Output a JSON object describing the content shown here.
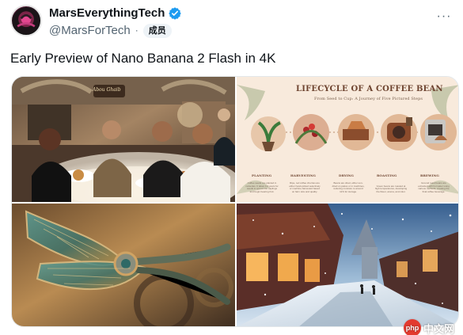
{
  "post": {
    "display_name": "MarsEverythingTech",
    "handle": "@MarsForTech",
    "separator": "·",
    "member_badge": "成员",
    "text": "Early Preview of Nano Banana 2 Flash in 4K",
    "menu": "···"
  },
  "icons": {
    "avatar": "mars-avatar-icon",
    "verified": "verified-badge-icon",
    "menu": "more-icon",
    "watermark": "php-logo-icon"
  },
  "media": [
    {
      "name": "restaurant-image",
      "sign": "Abou Ghaib"
    },
    {
      "name": "coffee-lifecycle-image",
      "title": "LIFECYCLE OF A COFFEE BEAN",
      "subtitle": "From Seed to Cup: A Journey of Five Pictured Steps",
      "stages": [
        {
          "label": "PLANTING",
          "note": "Coffee seeds are planted in nurseries. It takes 3-4 years for seeds to sprout into saplings and begin bearing fruit."
        },
        {
          "label": "HARVESTING",
          "note": "Ripe, red coffee cherries are either hand-picked selectively or machine-harvested based on farm size and quality."
        },
        {
          "label": "DRYING",
          "note": "Beans are dried, either sun-dried on patios or in machines, reducing moisture to around 11% for storage."
        },
        {
          "label": "ROASTING",
          "note": "Green beans are roasted at high temperatures, developing the flavor, aroma, and color."
        },
        {
          "label": "BREWING",
          "note": "Ground roast beans are extracted with hot water using various methods, creating the final coffee beverage."
        }
      ]
    },
    {
      "name": "mechanical-insect-image"
    },
    {
      "name": "snowy-street-image"
    }
  ],
  "watermark": {
    "logo_text": "php",
    "text": "中文网"
  },
  "colors": {
    "verified_blue": "#1d9bf0",
    "handle_gray": "#536471",
    "text_black": "#0f1419",
    "coffee_brown": "#6e4430"
  }
}
